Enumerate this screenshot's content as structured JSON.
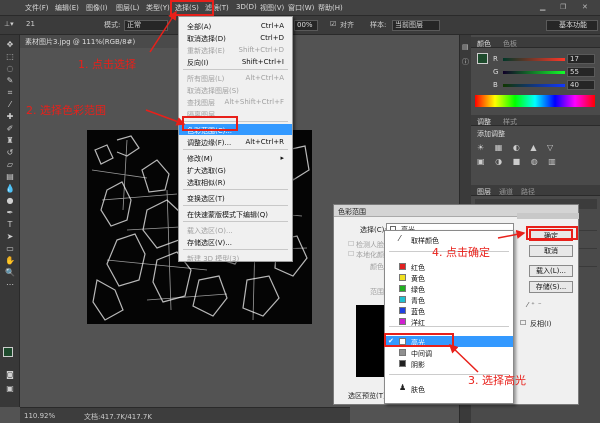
{
  "menubar": {
    "items": [
      "文件(F)",
      "编辑(E)",
      "图像(I)",
      "图层(L)",
      "类型(Y)",
      "选择(S)",
      "滤镜(T)",
      "3D(D)",
      "视图(V)",
      "窗口(W)",
      "帮助(H)"
    ]
  },
  "options": {
    "feather_size": "21",
    "mode_label": "模式:",
    "mode_value": "正常",
    "opacity": "00%",
    "align_label": "对齐",
    "sample_label": "样本:",
    "sample_value": "当前图层",
    "workspace": "基本功能"
  },
  "document": {
    "tab_title": "素材图片3.jpg @ 111%(RGB/8#)",
    "zoom": "110.92%",
    "doc_size": "文档:417.7K/417.7K"
  },
  "select_menu": {
    "items": [
      {
        "label": "全部(A)",
        "shortcut": "Ctrl+A",
        "disabled": false
      },
      {
        "label": "取消选择(D)",
        "shortcut": "Ctrl+D",
        "disabled": false
      },
      {
        "label": "重新选择(E)",
        "shortcut": "Shift+Ctrl+D",
        "disabled": true
      },
      {
        "label": "反向(I)",
        "shortcut": "Shift+Ctrl+I",
        "disabled": false
      },
      {
        "label": "所有图层(L)",
        "shortcut": "Alt+Ctrl+A",
        "disabled": true
      },
      {
        "label": "取消选择图层(S)",
        "shortcut": "",
        "disabled": true
      },
      {
        "label": "查找图层",
        "shortcut": "Alt+Shift+Ctrl+F",
        "disabled": true
      },
      {
        "label": "隔离图层",
        "shortcut": "",
        "disabled": true
      },
      {
        "label": "色彩范围(C)...",
        "shortcut": "",
        "disabled": false,
        "highlighted": true
      },
      {
        "label": "调整边缘(F)...",
        "shortcut": "Alt+Ctrl+R",
        "disabled": false
      },
      {
        "label": "修改(M)",
        "shortcut": "▸",
        "disabled": false
      },
      {
        "label": "扩大选取(G)",
        "shortcut": "",
        "disabled": false
      },
      {
        "label": "选取相似(R)",
        "shortcut": "",
        "disabled": false
      },
      {
        "label": "变换选区(T)",
        "shortcut": "",
        "disabled": false
      },
      {
        "label": "在快速蒙版模式下编辑(Q)",
        "shortcut": "",
        "disabled": false
      },
      {
        "label": "载入选区(O)...",
        "shortcut": "",
        "disabled": true
      },
      {
        "label": "存储选区(V)...",
        "shortcut": "",
        "disabled": false
      },
      {
        "label": "新建 3D 模型(3)",
        "shortcut": "",
        "disabled": true
      }
    ]
  },
  "dialog": {
    "title": "色彩范围",
    "select_label": "选择(C):",
    "select_value": "高光",
    "localized_label": "检测人脸(D)",
    "localized2_label": "本地化颜色簇(Z)",
    "fuzziness_label": "颜色容差",
    "range_label": "范围(R):",
    "preview_label": "选区预览(T):",
    "ok": "确定",
    "cancel": "取消",
    "load": "载入(L)...",
    "save": "存储(S)...",
    "invert": "反相(I)"
  },
  "select_dropdown": {
    "items": [
      {
        "label": "取样颜色",
        "color": "",
        "icon": "eyedropper"
      },
      {
        "label": "红色",
        "color": "#e02020"
      },
      {
        "label": "黄色",
        "color": "#f0e020"
      },
      {
        "label": "绿色",
        "color": "#20b020"
      },
      {
        "label": "青色",
        "color": "#20c0d0"
      },
      {
        "label": "蓝色",
        "color": "#2040e0"
      },
      {
        "label": "洋红",
        "color": "#d020d0"
      },
      {
        "label": "高光",
        "color": "#ffffff",
        "checked": true
      },
      {
        "label": "中间调",
        "color": "#909090"
      },
      {
        "label": "阴影",
        "color": "#202020"
      },
      {
        "label": "肤色",
        "color": "",
        "icon": "person"
      }
    ]
  },
  "panels": {
    "color_tabs": [
      "颜色",
      "色板"
    ],
    "rgb": {
      "r": "17",
      "g": "55",
      "b": "40"
    },
    "adjust_tabs": [
      "调整",
      "样式"
    ],
    "adjust_title": "添加调整",
    "layers_tabs": [
      "图层",
      "通道",
      "路径"
    ]
  },
  "annotations": {
    "step1": "1. 点击选择",
    "step2": "2. 选择色彩范围",
    "step3": "3. 选择高光",
    "step4": "4. 点击确定"
  }
}
